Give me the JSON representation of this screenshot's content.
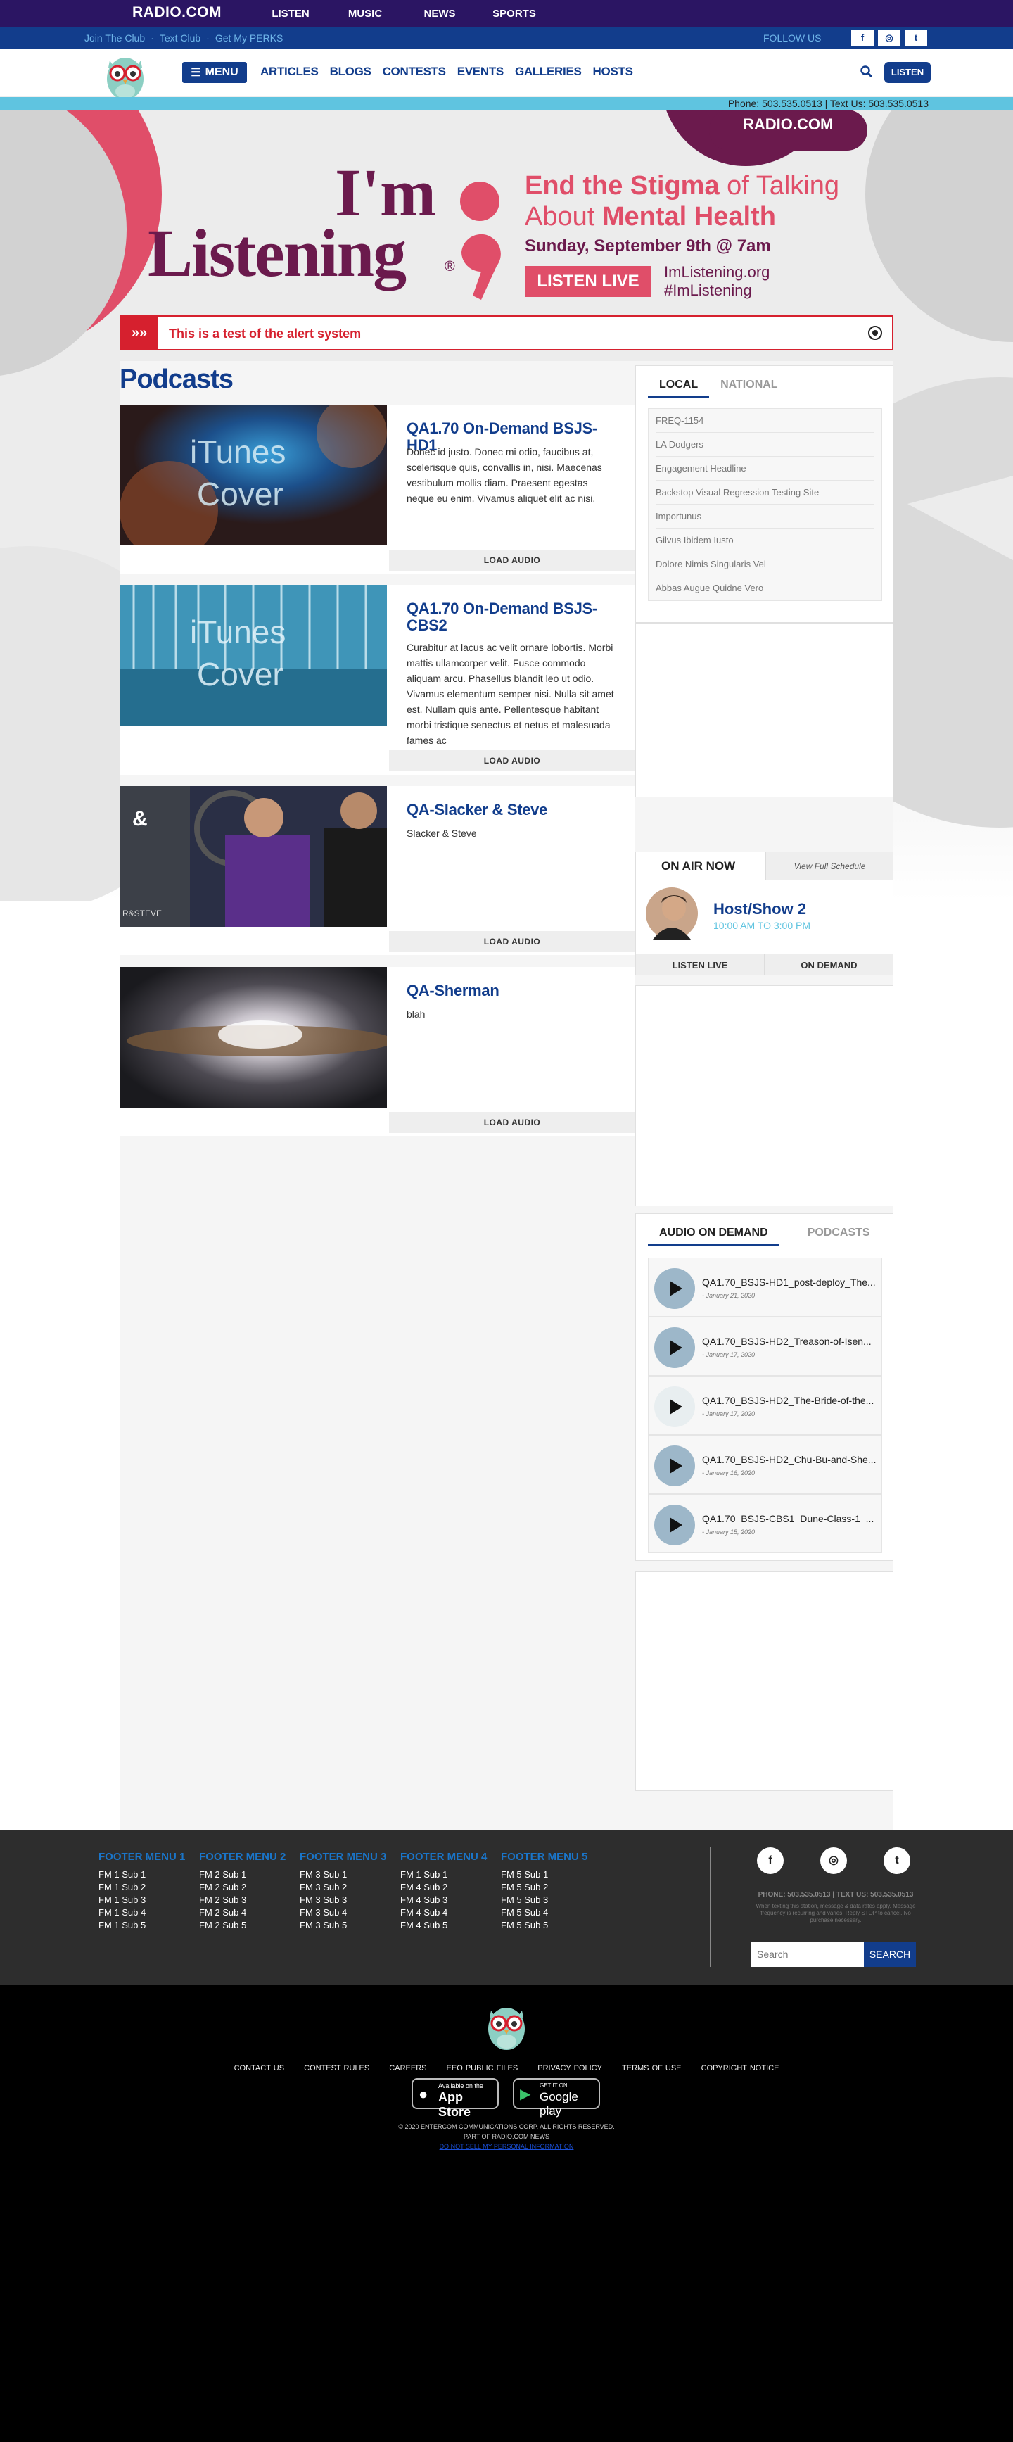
{
  "topbar": {
    "logo": "RADIO.COM",
    "nav": [
      "LISTEN",
      "MUSIC",
      "NEWS",
      "SPORTS"
    ]
  },
  "secondary": {
    "links": [
      "Join The Club",
      "·",
      "Text Club",
      "·",
      "Get My PERKS"
    ],
    "follow_label": "FOLLOW US",
    "social": [
      "f",
      "◎",
      "t"
    ]
  },
  "mainnav": {
    "menu_label": "MENU",
    "links": [
      "ARTICLES",
      "BLOGS",
      "CONTESTS",
      "EVENTS",
      "GALLERIES",
      "HOSTS"
    ],
    "listen_label": "LISTEN"
  },
  "phonebar": {
    "text": "Phone: 503.535.0513 | Text Us: 503.535.0513"
  },
  "banner": {
    "badge": "RADIO.COM",
    "headline_1": "I'm",
    "headline_2": "Listening",
    "reg": "®",
    "tagline_a": "End the Stigma",
    "tagline_b": " of Talking",
    "tagline_c": "About ",
    "tagline_d": "Mental Health",
    "date": "Sunday, September 9th @ 7am",
    "cta": "LISTEN LIVE",
    "site": "ImListening.org",
    "hashtag": "#ImListening"
  },
  "alert": {
    "text": "This is a test of the alert system"
  },
  "podcasts": {
    "title": "Podcasts",
    "load_label": "LOAD AUDIO",
    "items": [
      {
        "name": "QA1.70 On-Demand BSJS-HD1",
        "desc": "Donec id justo. Donec mi odio, faucibus at, scelerisque quis, convallis in, nisi. Maecenas vestibulum mollis diam. Praesent egestas neque eu enim. Vivamus aliquet elit ac nisi.",
        "img_text_1": "iTunes",
        "img_text_2": "Cover"
      },
      {
        "name": "QA1.70 On-Demand BSJS-CBS2",
        "desc": "Curabitur at lacus ac velit ornare lobortis. Morbi mattis ullamcorper velit. Fusce commodo aliquam arcu. Phasellus blandit leo ut odio. Vivamus elementum semper nisi. Nulla sit amet est. Nullam quis ante. Pellentesque habitant morbi tristique senectus et netus et malesuada fames ac",
        "img_text_1": "iTunes",
        "img_text_2": "Cover"
      },
      {
        "name": "QA-Slacker & Steve",
        "desc": "Slacker & Steve",
        "img_text_1": "&",
        "img_text_2": "R&STEVE"
      },
      {
        "name": "QA-Sherman",
        "desc": "blah"
      }
    ]
  },
  "sidebar": {
    "tabs": [
      "LOCAL",
      "NATIONAL"
    ],
    "local": [
      "FREQ-1154",
      "LA Dodgers",
      "Engagement Headline",
      "Backstop Visual Regression Testing Site",
      "Importunus",
      "Gilvus Ibidem Iusto",
      "Dolore Nimis Singularis Vel",
      "Abbas Augue Quidne Vero"
    ],
    "onair": {
      "label": "ON AIR NOW",
      "schedule": "View Full Schedule",
      "host": "Host/Show 2",
      "time": "10:00 AM TO 3:00 PM",
      "listen": "LISTEN LIVE",
      "ondemand": "ON DEMAND"
    },
    "aod_tabs": [
      "AUDIO ON DEMAND",
      "PODCASTS"
    ],
    "aod": [
      {
        "title": "QA1.70_BSJS-HD1_post-deploy_The...",
        "date": "- January 21, 2020"
      },
      {
        "title": "QA1.70_BSJS-HD2_Treason-of-Isen...",
        "date": "- January 17, 2020"
      },
      {
        "title": "QA1.70_BSJS-HD2_The-Bride-of-the...",
        "date": "- January 17, 2020"
      },
      {
        "title": "QA1.70_BSJS-HD2_Chu-Bu-and-She...",
        "date": "- January 16, 2020"
      },
      {
        "title": "QA1.70_BSJS-CBS1_Dune-Class-1_...",
        "date": "- January 15, 2020"
      }
    ]
  },
  "footer": {
    "menus": [
      {
        "title": "FOOTER MENU 1",
        "items": [
          "FM 1 Sub 1",
          "FM 1 Sub 2",
          "FM 1 Sub 3",
          "FM 1 Sub 4",
          "FM 1 Sub 5"
        ]
      },
      {
        "title": "FOOTER MENU 2",
        "items": [
          "FM 2 Sub 1",
          "FM 2 Sub 2",
          "FM 2 Sub 3",
          "FM 2 Sub 4",
          "FM 2 Sub 5"
        ]
      },
      {
        "title": "FOOTER MENU 3",
        "items": [
          "FM 3 Sub 1",
          "FM 3 Sub 2",
          "FM 3 Sub 3",
          "FM 3 Sub 4",
          "FM 3 Sub 5"
        ]
      },
      {
        "title": "FOOTER MENU 4",
        "items": [
          "FM 1 Sub 1",
          "FM 4 Sub 2",
          "FM 4 Sub 3",
          "FM 4 Sub 4",
          "FM 4 Sub 5"
        ]
      },
      {
        "title": "FOOTER MENU 5",
        "items": [
          "FM 5 Sub 1",
          "FM 5 Sub 2",
          "FM 5 Sub 3",
          "FM 5 Sub 4",
          "FM 5 Sub 5"
        ]
      }
    ],
    "social": [
      "f",
      "◎",
      "t"
    ],
    "phone": "PHONE: 503.535.0513 | TEXT US: 503.535.0513",
    "disclaimer": "When texting this station, message & data rates apply. Message frequency is recurring and varies. Reply STOP to cancel. No purchase necessary.",
    "search_placeholder": "Search",
    "search_button": "SEARCH"
  },
  "legal": {
    "links": [
      "CONTACT US",
      "CONTEST RULES",
      "CAREERS",
      "EEO PUBLIC FILES",
      "PRIVACY POLICY",
      "TERMS OF USE",
      "COPYRIGHT NOTICE"
    ],
    "appstore_small": "Available on the",
    "appstore": "App Store",
    "gplay_small": "GET IT ON",
    "gplay": "Google play",
    "copyright": "© 2020 ENTERCOM COMMUNICATIONS CORP. ALL RIGHTS RESERVED.",
    "part_of": "PART OF RADIO.COM NEWS",
    "dnsmpi": "DO NOT SELL MY PERSONAL INFORMATION"
  }
}
